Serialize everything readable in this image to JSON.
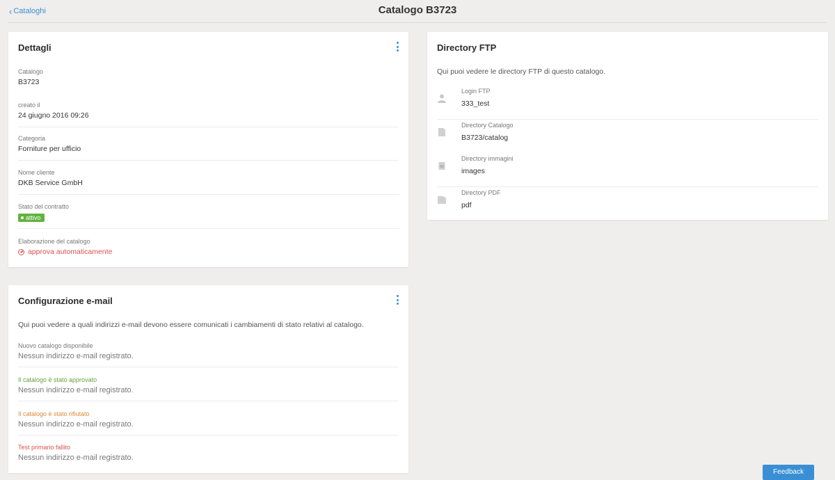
{
  "header": {
    "back_label": "Cataloghi",
    "title": "Catalogo B3723"
  },
  "details": {
    "title": "Dettagli",
    "fields": [
      {
        "label": "Catalogo",
        "value": "B3723"
      },
      {
        "label": "creato il",
        "value": "24 giugno 2016 09:26"
      },
      {
        "label": "Categoria",
        "value": "Forniture per ufficio"
      },
      {
        "label": "Nome cliente",
        "value": "DKB Service GmbH"
      },
      {
        "label": "Stato del contratto",
        "value": "attivo"
      },
      {
        "label": "Elaborazione del catalogo",
        "value": "approva automaticamente"
      }
    ]
  },
  "email": {
    "title": "Configurazione e-mail",
    "description": "Qui puoi vedere a quali indirizzi e-mail devono essere comunicati i cambiamenti di stato relativi al catalogo.",
    "items": [
      {
        "label": "Nuovo catalogo disponibile",
        "value": "Nessun indirizzo e-mail registrato."
      },
      {
        "label": "Il catalogo è stato approvato",
        "value": "Nessun indirizzo e-mail registrato."
      },
      {
        "label": "Il catalogo è stato rifiutato",
        "value": "Nessun indirizzo e-mail registrato."
      },
      {
        "label": "Test primario fallito",
        "value": "Nessun indirizzo e-mail registrato."
      }
    ]
  },
  "ftp": {
    "title": "Directory FTP",
    "description": "Qui puoi vedere le directory FTP di questo catalogo.",
    "items": [
      {
        "icon": "user-icon",
        "label": "Login FTP",
        "value": "333_test"
      },
      {
        "icon": "document-icon",
        "label": "Directory Catalogo",
        "value": "B3723/catalog"
      },
      {
        "icon": "image-icon",
        "label": "Directory immagini",
        "value": "images"
      },
      {
        "icon": "pdf-icon",
        "label": "Directory PDF",
        "value": "pdf"
      }
    ]
  },
  "feedback_label": "Feedback",
  "colors": {
    "accent": "#3a8fd4",
    "success": "#62b23e",
    "danger": "#d9534f",
    "warning": "#e08a3a",
    "background": "#efeeed"
  }
}
